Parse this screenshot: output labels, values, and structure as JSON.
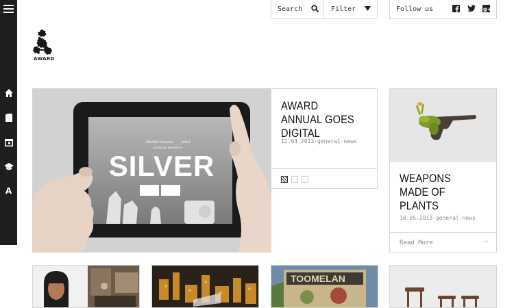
{
  "nav": {
    "menu_icon": "hamburger-icon",
    "items": [
      {
        "name": "home",
        "icon": "home-icon"
      },
      {
        "name": "bookmark",
        "icon": "bookmark-icon"
      },
      {
        "name": "calendar",
        "icon": "calendar-icon"
      },
      {
        "name": "education",
        "icon": "mortarboard-icon"
      },
      {
        "name": "award",
        "label": "A"
      }
    ]
  },
  "topbar": {
    "search_label": "Search",
    "filter_label": "Filter",
    "follow_label": "Follow us",
    "social": [
      "facebook-icon",
      "twitter-icon",
      "google-plus-icon"
    ]
  },
  "logo": {
    "text": "AWARD"
  },
  "hero": {
    "title": "AWARD ANNUAL GOES DIGITAL",
    "meta": "12.04.2013-general-news",
    "tablet": {
      "header": "AWARD Awards_____2012",
      "subheader": "proudly presents",
      "headline": "SILVER"
    },
    "slides_total": 3,
    "active_slide": 1
  },
  "side_card": {
    "title": "WEAPONS MADE OF PLANTS",
    "meta": "16.05.2013-general-news",
    "read_more": "Read More",
    "arrow": "→"
  },
  "colors": {
    "rail": "#1e1e1e",
    "border": "#d6d6d6",
    "meta": "#888888"
  }
}
